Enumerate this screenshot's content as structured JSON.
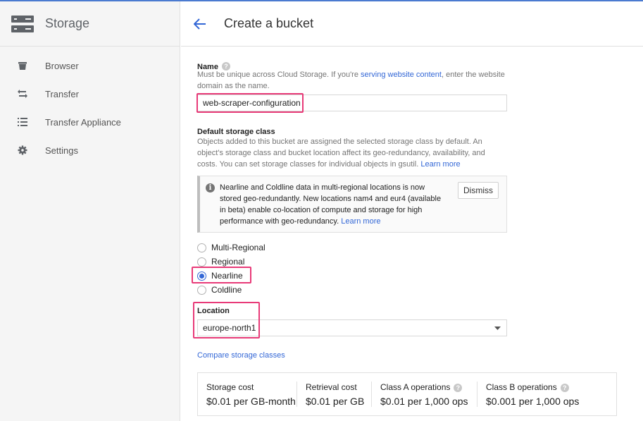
{
  "sidebar": {
    "title": "Storage",
    "items": [
      {
        "label": "Browser",
        "icon": "bucket-icon"
      },
      {
        "label": "Transfer",
        "icon": "transfer-arrows-icon"
      },
      {
        "label": "Transfer Appliance",
        "icon": "list-icon"
      },
      {
        "label": "Settings",
        "icon": "gear-icon"
      }
    ]
  },
  "header": {
    "title": "Create a bucket"
  },
  "name_section": {
    "label": "Name",
    "desc_before": "Must be unique across Cloud Storage. If you're ",
    "desc_link": "serving website content",
    "desc_after": ", enter the website domain as the name.",
    "value": "web-scraper-configuration"
  },
  "storage_class": {
    "label": "Default storage class",
    "desc": "Objects added to this bucket are assigned the selected storage class by default. An object's storage class and bucket location affect its geo-redundancy, availability, and costs. You can set storage classes for individual objects in gsutil.",
    "learn_more": "Learn more",
    "notice": {
      "text": "Nearline and Coldline data in multi-regional locations is now stored geo-redundantly. New locations nam4 and eur4 (available in beta) enable co-location of compute and storage for high performance with geo-redundancy.",
      "learn_more": "Learn more",
      "dismiss": "Dismiss"
    },
    "options": [
      {
        "label": "Multi-Regional",
        "selected": false
      },
      {
        "label": "Regional",
        "selected": false
      },
      {
        "label": "Nearline",
        "selected": true
      },
      {
        "label": "Coldline",
        "selected": false
      }
    ]
  },
  "location": {
    "label": "Location",
    "value": "europe-north1"
  },
  "compare_link": "Compare storage classes",
  "costs": [
    {
      "head": "Storage cost",
      "value": "$0.01 per GB-month",
      "help": false
    },
    {
      "head": "Retrieval cost",
      "value": "$0.01 per GB",
      "help": false
    },
    {
      "head": "Class A operations",
      "value": "$0.01 per 1,000 ops",
      "help": true
    },
    {
      "head": "Class B operations",
      "value": "$0.001 per 1,000 ops",
      "help": true
    }
  ],
  "colors": {
    "accent": "#3367d6",
    "highlight": "#e83a78",
    "sidebar_bg": "#f5f5f5"
  }
}
